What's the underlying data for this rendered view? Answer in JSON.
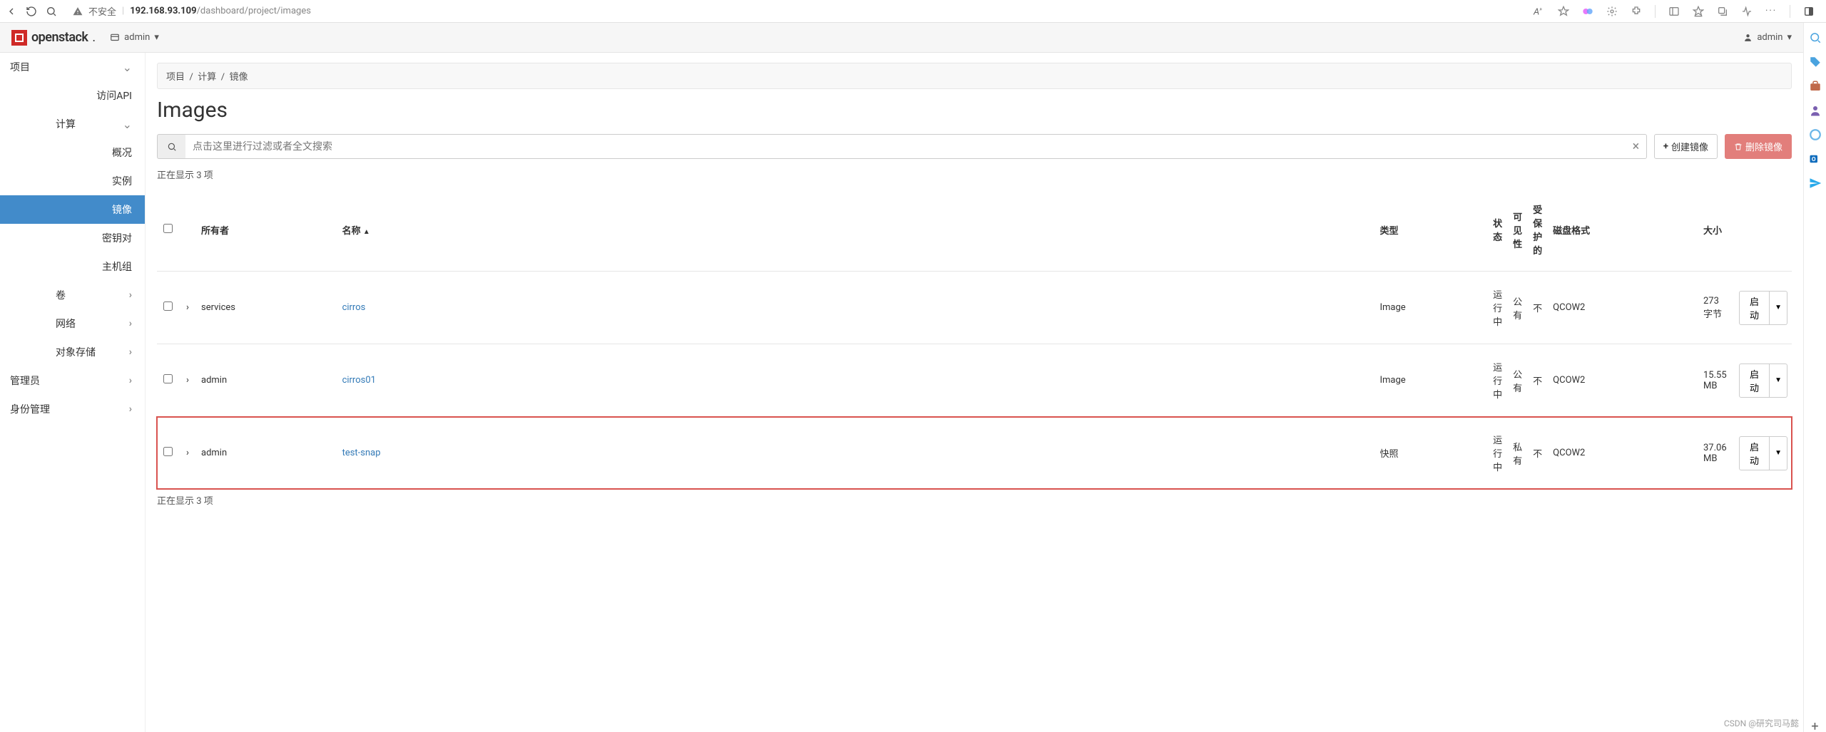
{
  "browser": {
    "insecure_label": "不安全",
    "url_host": "192.168.93.109",
    "url_path": "/dashboard/project/images"
  },
  "topbar": {
    "brand": "openstack",
    "domain": "admin",
    "user": "admin"
  },
  "sidebar": {
    "project": "项目",
    "api": "访问API",
    "compute": "计算",
    "overview": "概况",
    "instance": "实例",
    "image": "镜像",
    "keypair": "密钥对",
    "hostgroup": "主机组",
    "volume": "卷",
    "network": "网络",
    "objectstore": "对象存储",
    "admin": "管理员",
    "identity": "身份管理"
  },
  "breadcrumbs": {
    "a": "项目",
    "b": "计算",
    "c": "镜像"
  },
  "page": {
    "title": "Images"
  },
  "search": {
    "placeholder": "点击这里进行过滤或者全文搜索"
  },
  "buttons": {
    "create": "创建镜像",
    "delete": "删除镜像"
  },
  "count_text": "正在显示 3 项",
  "columns": {
    "owner": "所有者",
    "name": "名称",
    "type": "类型",
    "status": "状态",
    "visibility": "可见性",
    "protected": "受保护的",
    "diskformat": "磁盘格式",
    "size": "大小"
  },
  "rows": [
    {
      "owner": "services",
      "name": "cirros",
      "type": "Image",
      "status": "运行中",
      "visibility": "公有",
      "protected": "不",
      "diskformat": "QCOW2",
      "size": "273 字节",
      "action": "启动"
    },
    {
      "owner": "admin",
      "name": "cirros01",
      "type": "Image",
      "status": "运行中",
      "visibility": "公有",
      "protected": "不",
      "diskformat": "QCOW2",
      "size": "15.55 MB",
      "action": "启动"
    },
    {
      "owner": "admin",
      "name": "test-snap",
      "type": "快照",
      "status": "运行中",
      "visibility": "私有",
      "protected": "不",
      "diskformat": "QCOW2",
      "size": "37.06 MB",
      "action": "启动"
    }
  ],
  "watermark": "CSDN @研究司马懿"
}
